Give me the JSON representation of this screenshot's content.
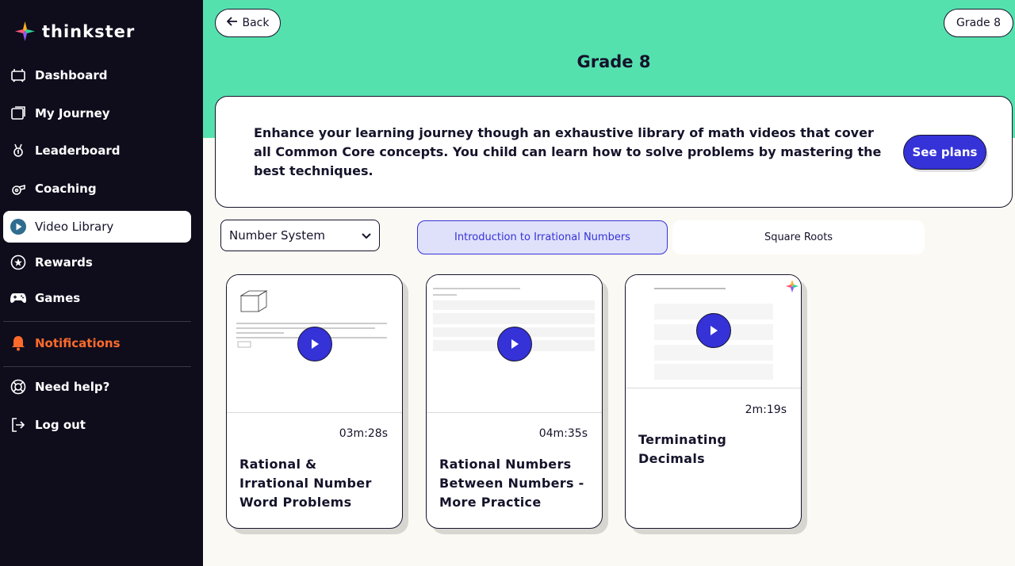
{
  "brand": {
    "name": "thinkster"
  },
  "sidebar": {
    "items": [
      {
        "label": "Dashboard",
        "icon": "dashboard-icon"
      },
      {
        "label": "My Journey",
        "icon": "journey-icon"
      },
      {
        "label": "Leaderboard",
        "icon": "trophy-icon"
      },
      {
        "label": "Coaching",
        "icon": "whistle-icon"
      },
      {
        "label": "Video Library",
        "icon": "play-circle-icon",
        "active": true
      },
      {
        "label": "Rewards",
        "icon": "star-icon"
      },
      {
        "label": "Games",
        "icon": "gamepad-icon"
      }
    ],
    "notifications": {
      "label": "Notifications",
      "icon": "bell-icon",
      "color": "#ff6a2b"
    },
    "help": {
      "label": "Need help?",
      "icon": "lifebuoy-icon"
    },
    "logout": {
      "label": "Log out",
      "icon": "logout-icon"
    }
  },
  "header": {
    "back_label": "Back",
    "grade_pill": "Grade 8",
    "title": "Grade 8"
  },
  "promo": {
    "text": "Enhance your learning journey though an exhaustive library of math videos that cover all Common Core concepts. You child can learn how to solve problems by mastering the best techniques.",
    "button_label": "See plans"
  },
  "filters": {
    "topic_selected": "Number System",
    "tabs": [
      {
        "label": "Introduction to Irrational Numbers",
        "active": true
      },
      {
        "label": "Square Roots",
        "active": false
      }
    ]
  },
  "videos": [
    {
      "duration": "03m:28s",
      "title": "Rational & Irrational Number Word Problems"
    },
    {
      "duration": "04m:35s",
      "title": "Rational Numbers Between Numbers - More Practice"
    },
    {
      "duration": "2m:19s",
      "title": "Terminating Decimals"
    }
  ],
  "colors": {
    "sidebar_bg": "#0f0d1c",
    "hero_bg": "#55e1ae",
    "accent": "#3532d8",
    "notification": "#ff6a2b",
    "page_bg": "#fbf9f3"
  }
}
